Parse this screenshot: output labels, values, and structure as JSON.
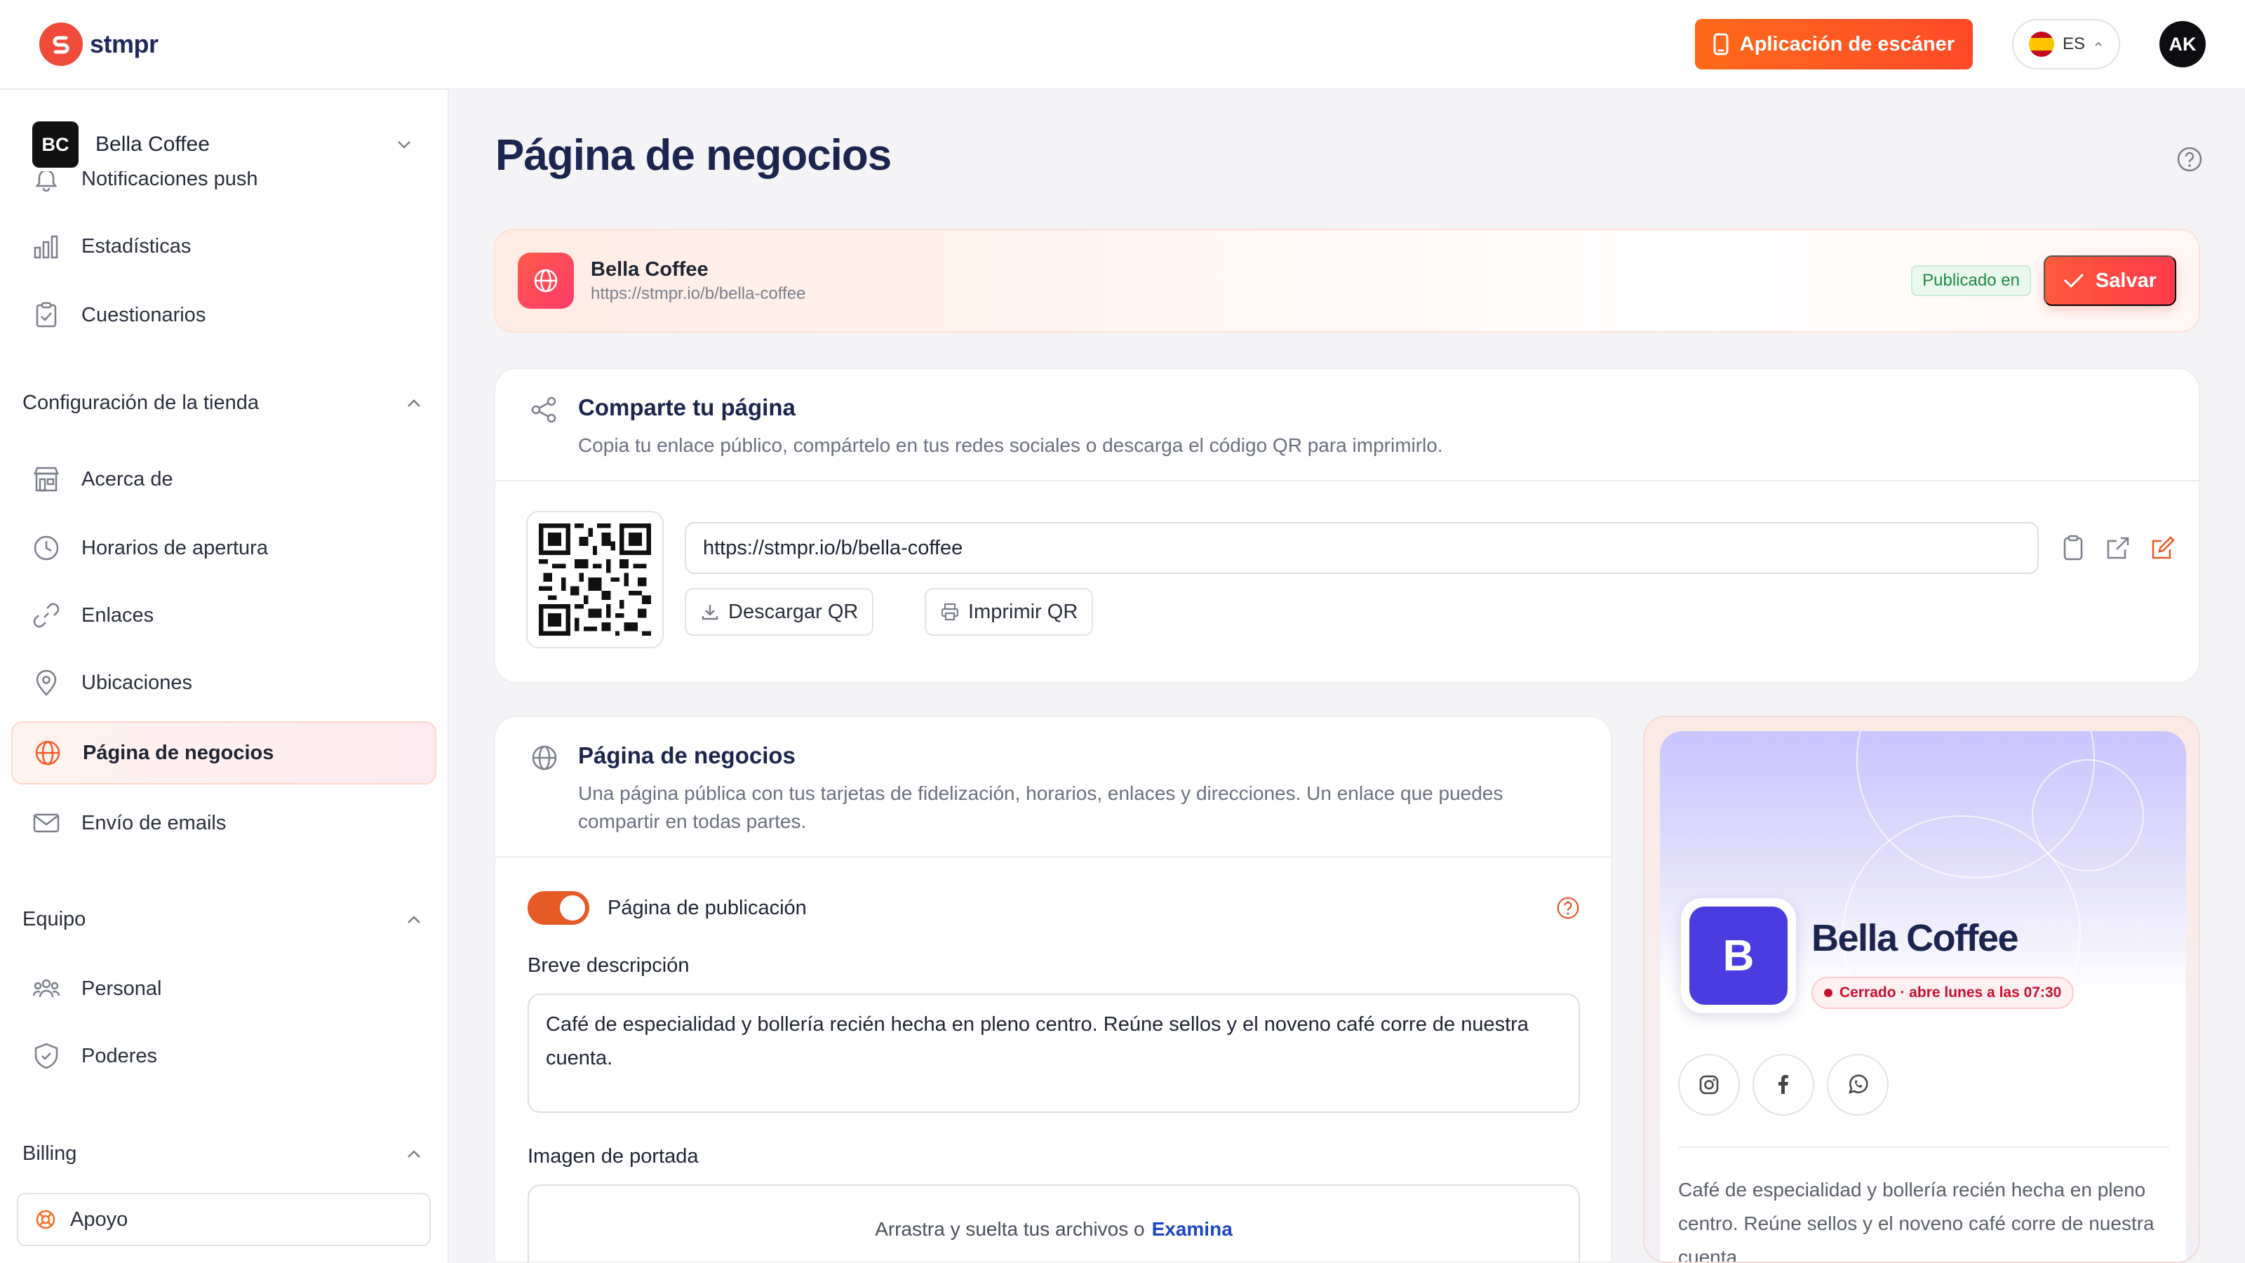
{
  "brand": {
    "name": "stmpr"
  },
  "header": {
    "scanner_button": "Aplicación de escáner",
    "language_code": "ES",
    "user_initials": "AK"
  },
  "sidebar": {
    "business": {
      "initials": "BC",
      "name": "Bella Coffee"
    },
    "items_top": [
      {
        "label": "Notificaciones push",
        "icon": "bell-icon"
      },
      {
        "label": "Estadísticas",
        "icon": "bar-chart-icon"
      },
      {
        "label": "Cuestionarios",
        "icon": "clipboard-icon"
      }
    ],
    "store_section": "Configuración de la tienda",
    "store_items": [
      {
        "label": "Acerca de",
        "icon": "store-icon"
      },
      {
        "label": "Horarios de apertura",
        "icon": "clock-icon"
      },
      {
        "label": "Enlaces",
        "icon": "link-icon"
      },
      {
        "label": "Ubicaciones",
        "icon": "map-pin-icon"
      },
      {
        "label": "Página de negocios",
        "icon": "globe-icon",
        "active": true
      },
      {
        "label": "Envío de emails",
        "icon": "mail-icon"
      }
    ],
    "team_section": "Equipo",
    "team_items": [
      {
        "label": "Personal",
        "icon": "users-icon"
      },
      {
        "label": "Poderes",
        "icon": "shield-icon"
      }
    ],
    "billing_section": "Billing",
    "support_label": "Apoyo"
  },
  "main": {
    "title": "Página de negocios",
    "publish_bar": {
      "name": "Bella Coffee",
      "url": "https://stmpr.io/b/bella-coffee",
      "status": "Publicado en",
      "save_label": "Salvar"
    },
    "share": {
      "title": "Comparte tu página",
      "subtitle": "Copia tu enlace público, compártelo en tus redes sociales o descarga el código QR para imprimirlo.",
      "url": "https://stmpr.io/b/bella-coffee",
      "download_qr": "Descargar QR",
      "print_qr": "Imprimir QR"
    },
    "business_page": {
      "title": "Página de negocios",
      "subtitle_line1": "Una página pública con tus tarjetas de fidelización, horarios, enlaces y direcciones. Un enlace que puedes",
      "subtitle_line2": "compartir en todas partes.",
      "toggle_label": "Página de publicación",
      "toggle_on": true,
      "short_desc_label": "Breve descripción",
      "short_desc_value": "Café de especialidad y bollería recién hecha en pleno centro. Reúne sellos y el noveno café corre de nuestra cuenta.",
      "cover_label": "Imagen de portada",
      "dropzone_text": "Arrastra y suelta tus archivos o",
      "dropzone_link": "Examina"
    },
    "preview": {
      "logo_letter": "B",
      "name": "Bella Coffee",
      "status": "Cerrado · abre lunes a las 07:30",
      "social": [
        "instagram-icon",
        "facebook-icon",
        "whatsapp-icon"
      ],
      "description_lines": [
        "Café de especialidad y bollería recién hecha en pleno",
        "centro. Reúne sellos y el noveno café corre de nuestra",
        "cuenta."
      ]
    }
  },
  "colors": {
    "accent": "#ff5a3a",
    "brand_navy": "#1b2550",
    "toggle_on": "#e55a26",
    "preview_logo": "#4a3de0"
  }
}
